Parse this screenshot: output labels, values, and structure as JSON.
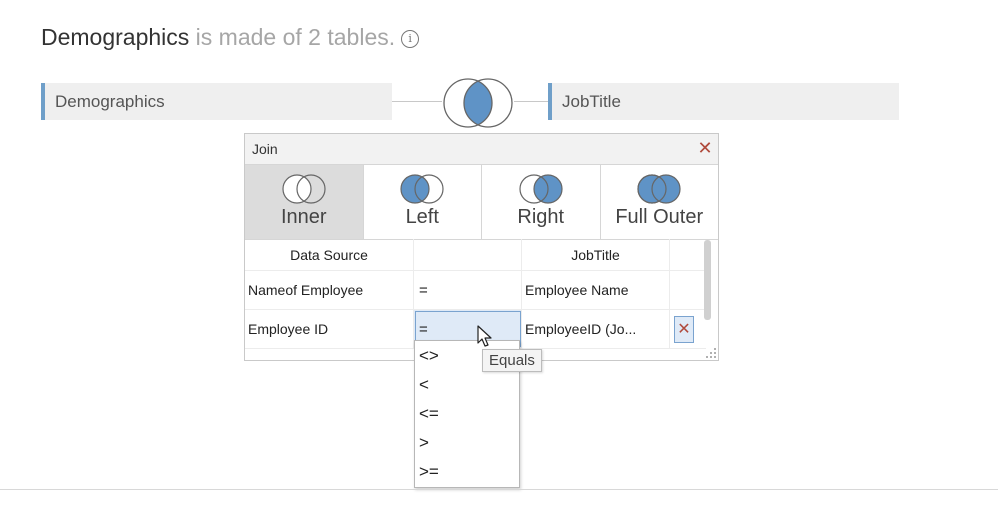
{
  "header": {
    "datasource_name": "Demographics",
    "made_of_text": " is made of 2 tables.",
    "info_icon": "info-icon"
  },
  "tables": {
    "left": "Demographics",
    "right": "JobTitle"
  },
  "colors": {
    "accent": "#6f9fc9",
    "venn_fill": "#5f93c6",
    "close": "#b04a3c"
  },
  "join_dialog": {
    "title": "Join",
    "join_types": [
      {
        "label": "Inner",
        "selected": true
      },
      {
        "label": "Left",
        "selected": false
      },
      {
        "label": "Right",
        "selected": false
      },
      {
        "label": "Full Outer",
        "selected": false
      }
    ],
    "columns": {
      "left": "Data Source",
      "right": "JobTitle"
    },
    "clauses": [
      {
        "left": "Nameof Employee",
        "operator": "=",
        "right": "Employee Name"
      },
      {
        "left": "Employee ID",
        "operator": "=",
        "right": "EmployeeID (Jo..."
      }
    ]
  },
  "operator_dropdown": {
    "options": [
      "<>",
      "<",
      "<=",
      ">",
      ">="
    ],
    "tooltip": "Equals"
  }
}
